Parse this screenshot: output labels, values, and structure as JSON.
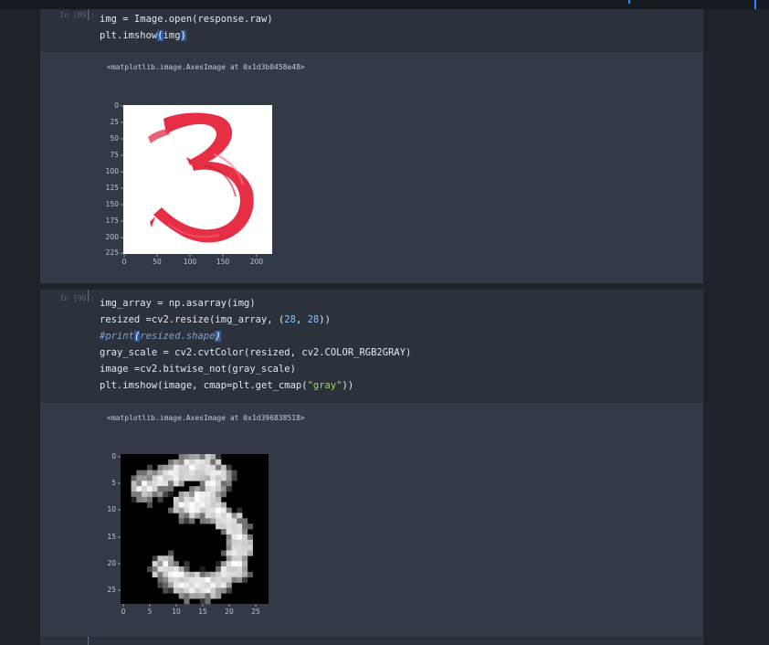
{
  "cells": [
    {
      "prompt": "In [89]:",
      "code_lines": [
        "img = Image.open(response.raw)",
        "plt.imshow(img)"
      ],
      "output_text": "<matplotlib.image.AxesImage at 0x1d3b0458e48>",
      "plot": {
        "image": "red brush-stroke digit 3 on white background",
        "x_ticks": [
          "0",
          "50",
          "100",
          "150",
          "200"
        ],
        "y_ticks": [
          "0",
          "25",
          "50",
          "75",
          "100",
          "125",
          "150",
          "175",
          "200",
          "225"
        ]
      }
    },
    {
      "prompt": "In [90]:",
      "code_lines": [
        "img_array = np.asarray(img)",
        "resized =cv2.resize(img_array, (28, 28))",
        "#print(resized.shape)",
        "gray_scale = cv2.cvtColor(resized, cv2.COLOR_RGB2GRAY)",
        "image =cv2.bitwise_not(gray_scale)",
        "plt.imshow(image, cmap=plt.get_cmap(\"gray\"))"
      ],
      "output_text": "<matplotlib.image.AxesImage at 0x1d396838518>",
      "plot": {
        "image": "28x28 grayscale inverted digit 3 on black background",
        "x_ticks": [
          "0",
          "5",
          "10",
          "15",
          "20",
          "25"
        ],
        "y_ticks": [
          "0",
          "5",
          "10",
          "15",
          "20",
          "25"
        ]
      }
    }
  ],
  "colors": {
    "page_bg": "#1e2329",
    "input_bg": "#2b323c",
    "output_bg": "#323a46",
    "text": "#e3e8ee",
    "number": "#84c2ff",
    "string": "#98d66a",
    "comment": "#7ea2d0",
    "highlight": "#2e5c9e"
  }
}
